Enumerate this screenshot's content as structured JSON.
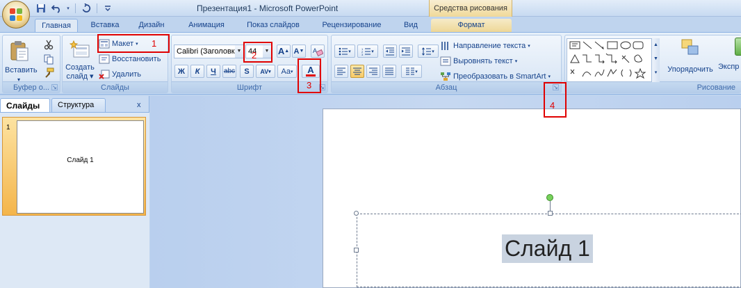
{
  "title_bar": {
    "window_title": "Презентация1 - Microsoft PowerPoint",
    "context_group": "Средства рисования"
  },
  "quick_access": [
    {
      "icon": "save-icon"
    },
    {
      "icon": "undo-icon"
    },
    {
      "icon": "redo-icon"
    },
    {
      "icon": "customize-qat-icon"
    }
  ],
  "tabs": [
    "Главная",
    "Вставка",
    "Дизайн",
    "Анимация",
    "Показ слайдов",
    "Рецензирование",
    "Вид",
    "Формат"
  ],
  "active_tab": "Главная",
  "ribbon": {
    "clipboard": {
      "label": "Буфер о...",
      "paste": "Вставить",
      "paste_arrow": "▾"
    },
    "slides": {
      "label": "Слайды",
      "new_slide_line1": "Создать",
      "new_slide_line2": "слайд ▾",
      "layout": "Макет",
      "reset": "Восстановить",
      "delete": "Удалить"
    },
    "font": {
      "label": "Шрифт",
      "font_name": "Calibri (Заголовк",
      "font_size": "44",
      "grow": "A",
      "shrink": "A",
      "clear_format": "A",
      "bold": "Ж",
      "italic": "К",
      "underline": "Ч",
      "strike": "abc",
      "shadow": "S",
      "spacing": "AV",
      "case": "Aa",
      "color": "A"
    },
    "paragraph": {
      "label": "Абзац",
      "text_direction": "Направление текста",
      "align_text": "Выровнять текст",
      "smartart": "Преобразовать в SmartArt"
    },
    "drawing": {
      "label": "Рисование",
      "arrange": "Упорядочить",
      "quick_styles": "Экспр"
    }
  },
  "annotations": [
    "1",
    "2",
    "3",
    "4"
  ],
  "side_panel": {
    "tab_slides": "Слайды",
    "tab_outline": "Структура",
    "close": "x",
    "slide_number": "1",
    "thumb_text": "Слайд 1"
  },
  "slide": {
    "title_text": "Слайд 1"
  },
  "colors": {
    "accent_blue": "#15428b",
    "annotation_red": "#e00000",
    "selected_thumb": "#f4b54b",
    "font_color_bar": "#e00000"
  }
}
